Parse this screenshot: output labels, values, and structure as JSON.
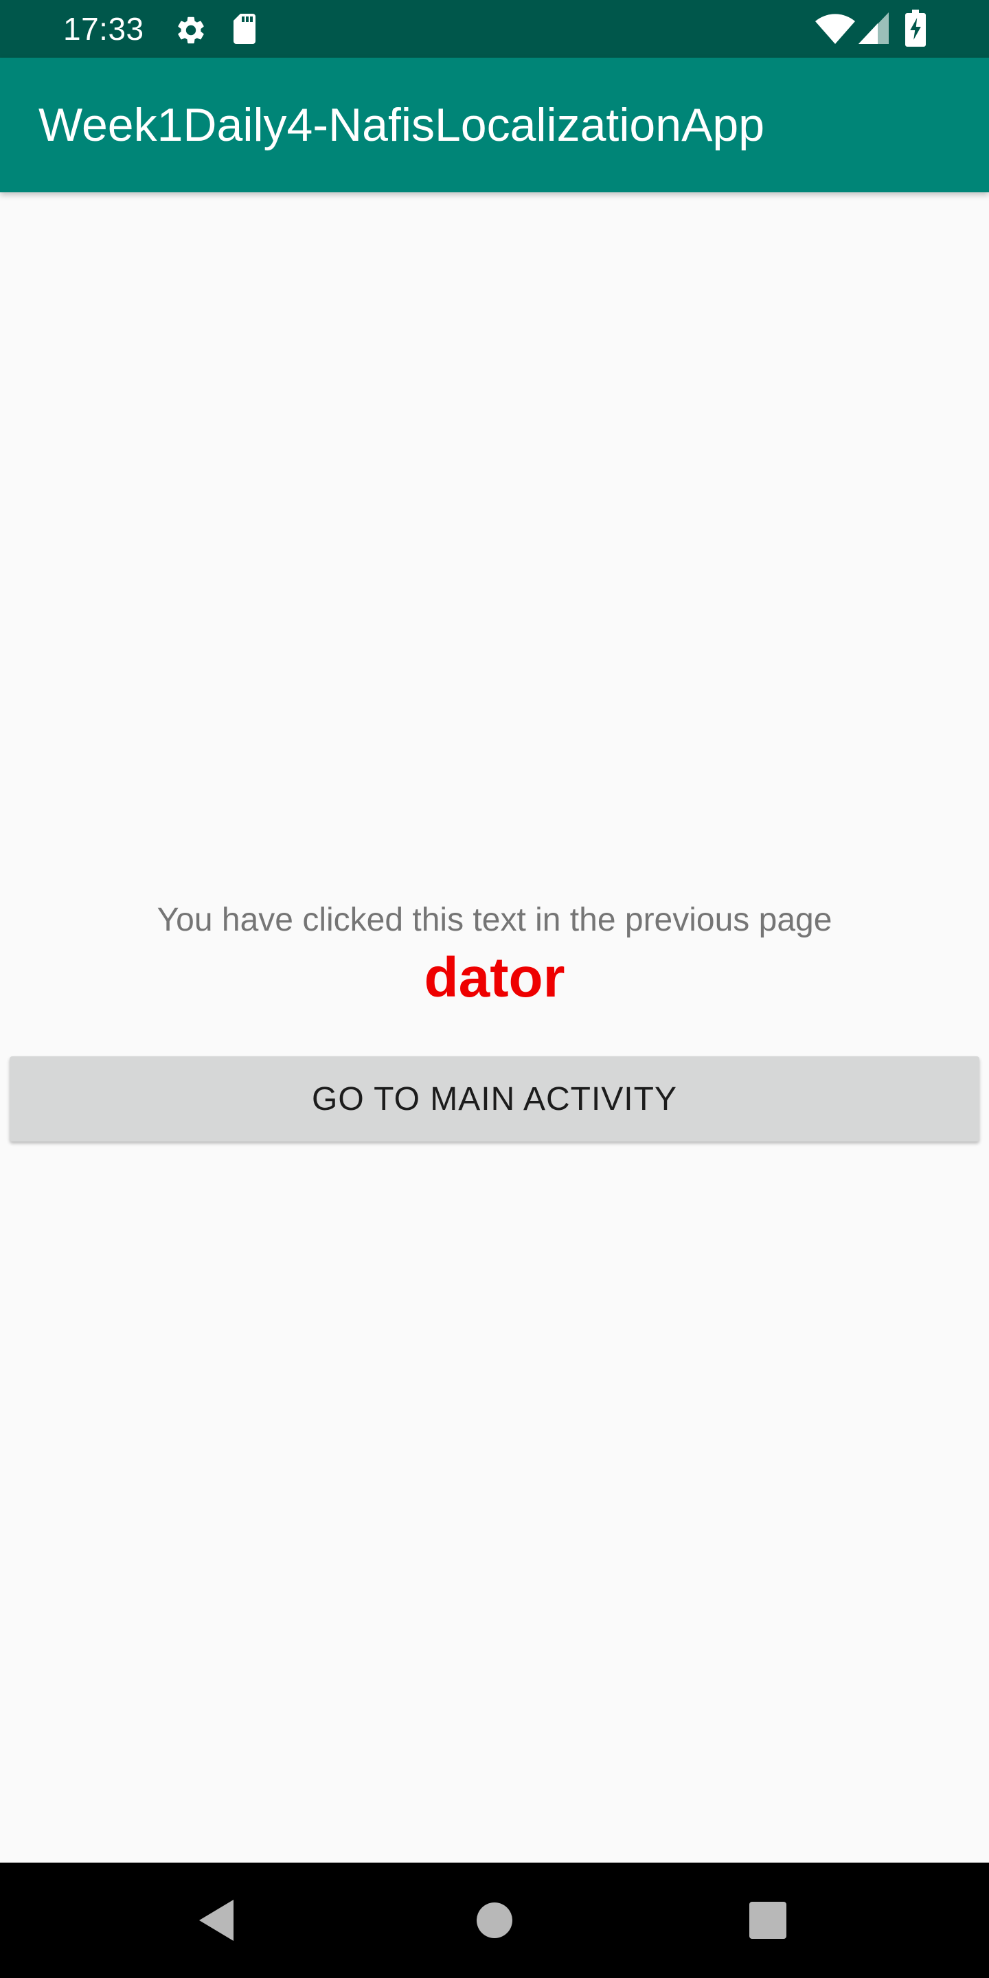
{
  "status_bar": {
    "time": "17:33",
    "icons": [
      "settings-gear-icon",
      "sd-card-icon",
      "wifi-icon",
      "cell-signal-icon",
      "battery-charging-icon"
    ]
  },
  "app_bar": {
    "title": "Week1Daily4-NafisLocalizationApp",
    "background_color": "#008577"
  },
  "content": {
    "info_text": "You have clicked this text in the previous page",
    "clicked_word": "dator",
    "clicked_word_color": "#ee0000",
    "button_label": "GO TO MAIN ACTIVITY"
  },
  "nav_bar": {
    "buttons": [
      "back-icon",
      "home-icon",
      "recents-icon"
    ]
  }
}
